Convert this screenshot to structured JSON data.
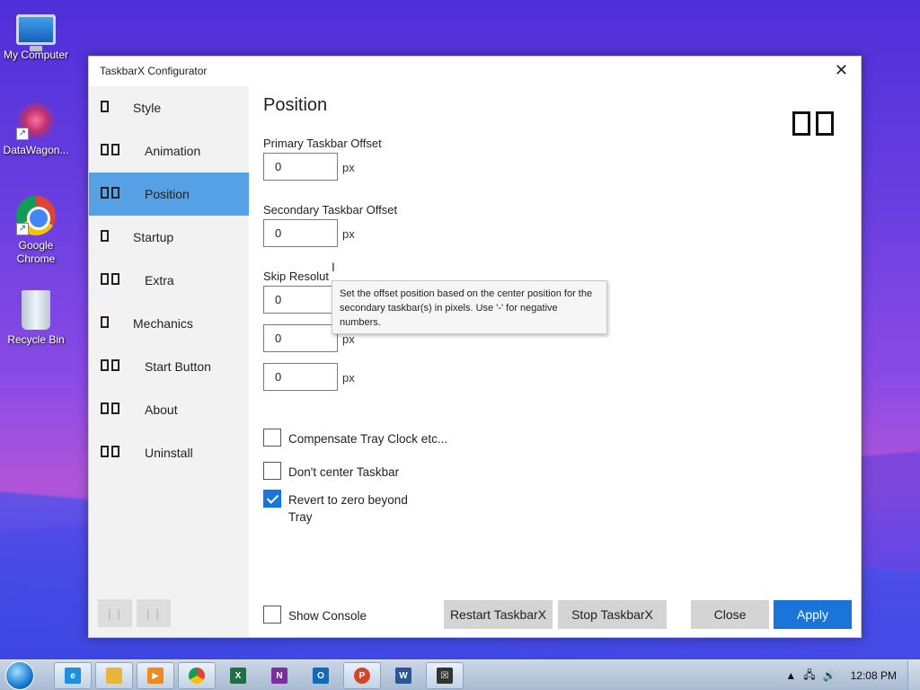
{
  "desktop": {
    "icons": [
      {
        "label": "My Computer",
        "icon": "computer-icon"
      },
      {
        "label": "DataWagon...",
        "icon": "datawagon-icon"
      },
      {
        "label": "Google Chrome",
        "icon": "chrome-icon"
      },
      {
        "label": "Recycle Bin",
        "icon": "recycle-bin-icon"
      }
    ]
  },
  "window": {
    "title": "TaskbarX Configurator",
    "close_glyph": "✕"
  },
  "sidebar": {
    "items": [
      {
        "label": "Style",
        "glyph_count": 1,
        "active": false
      },
      {
        "label": "Animation",
        "glyph_count": 2,
        "active": false
      },
      {
        "label": "Position",
        "glyph_count": 2,
        "active": true
      },
      {
        "label": "Startup",
        "glyph_count": 1,
        "active": false
      },
      {
        "label": "Extra",
        "glyph_count": 2,
        "active": false
      },
      {
        "label": "Mechanics",
        "glyph_count": 1,
        "active": false
      },
      {
        "label": "Start Button",
        "glyph_count": 2,
        "active": false
      },
      {
        "label": "About",
        "glyph_count": 2,
        "active": false
      },
      {
        "label": "Uninstall",
        "glyph_count": 2,
        "active": false
      }
    ],
    "bottom_buttons": [
      "| |",
      "| |"
    ]
  },
  "main": {
    "title": "Position",
    "primary_offset": {
      "label": "Primary Taskbar Offset",
      "value": "0",
      "unit": "px"
    },
    "secondary_offset": {
      "label": "Secondary Taskbar Offset",
      "value": "0",
      "unit": "px"
    },
    "skip_resolution": {
      "label": "Skip Resolut",
      "value": "0",
      "unit": "p"
    },
    "extra_fields": [
      {
        "value": "0",
        "unit": "px"
      },
      {
        "value": "0",
        "unit": "px"
      }
    ],
    "tooltip": "Set the offset position based on the center position for the secondary taskbar(s) in pixels. Use '-' for negative numbers.",
    "checkboxes": {
      "compensate": {
        "label": "Compensate Tray Clock etc...",
        "checked": false
      },
      "dont_center": {
        "label": "Don't center Taskbar",
        "checked": false
      },
      "revert_zero": {
        "label": "Revert to zero beyond Tray",
        "checked": true
      }
    },
    "show_console": {
      "label": "Show Console",
      "checked": false
    }
  },
  "buttons": {
    "restart": "Restart TaskbarX",
    "stop": "Stop TaskbarX",
    "close": "Close",
    "apply": "Apply"
  },
  "colors": {
    "accent": "#1a74d9",
    "sidebar_active": "#56a0e6",
    "sidebar_bg": "#f2f2f2"
  },
  "taskbar": {
    "apps": [
      "internet-explorer-icon",
      "file-explorer-icon",
      "media-player-icon",
      "chrome-icon",
      "excel-icon",
      "onenote-icon",
      "outlook-icon",
      "powerpoint-icon",
      "word-icon",
      "taskbarx-icon"
    ],
    "clock": "12:08 PM"
  }
}
